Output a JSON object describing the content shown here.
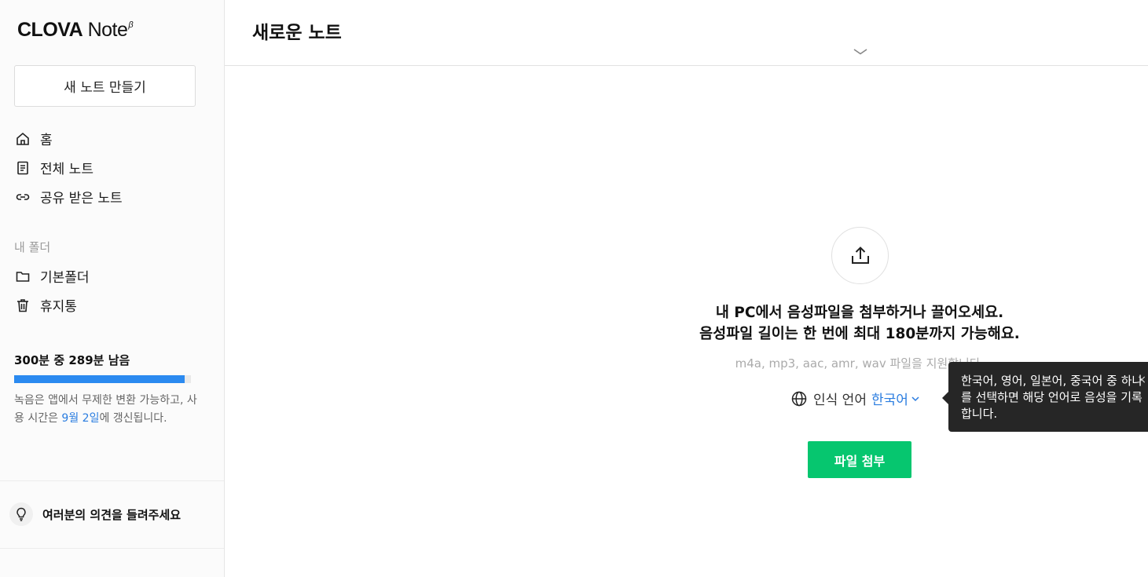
{
  "logo": {
    "part1": "CLOVA",
    "part2": " Note",
    "beta": "β"
  },
  "sidebar": {
    "new_note_label": "새 노트 만들기",
    "nav": [
      {
        "label": "홈",
        "icon": "home-icon"
      },
      {
        "label": "전체 노트",
        "icon": "document-icon"
      },
      {
        "label": "공유 받은 노트",
        "icon": "link-icon"
      }
    ],
    "folders_label": "내 폴더",
    "folders": [
      {
        "label": "기본폴더",
        "icon": "folder-icon"
      },
      {
        "label": "휴지통",
        "icon": "trash-icon"
      }
    ],
    "usage": {
      "title": "300분 중 289분 남음",
      "progress": 0.963,
      "desc_before": "녹음은 앱에서 무제한 변환 가능하고, 사용 시간은 ",
      "desc_date": "9월 2일",
      "desc_after": "에 갱신됩니다."
    },
    "feedback_label": "여러분의 의견을 들려주세요"
  },
  "main": {
    "title": "새로운 노트",
    "upload_line1": "내 PC에서 음성파일을 첨부하거나 끌어오세요.",
    "upload_line2": "음성파일 길이는 한 번에 최대 180분까지 가능해요.",
    "formats": "m4a, mp3, aac, amr, wav 파일을 지원합니다.",
    "language_label": "인식 언어",
    "language_value": "한국어",
    "attach_label": "파일 첨부",
    "tooltip": "한국어, 영어, 일본어, 중국어 중 하나를 선택하면 해당 언어로 음성을 기록합니다.",
    "tooltip_close": "×"
  },
  "colors": {
    "accent_green": "#06c66f",
    "progress_blue": "#2b8af0",
    "link_blue": "#2b7de0",
    "tooltip_bg": "#262626"
  }
}
